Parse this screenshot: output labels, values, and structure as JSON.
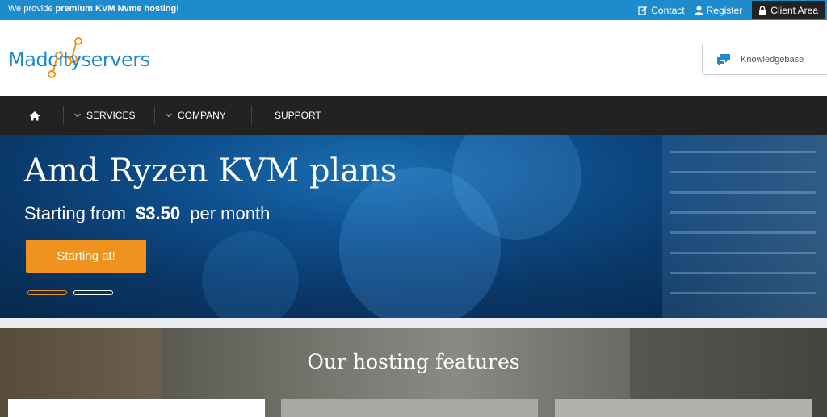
{
  "topbar": {
    "promo_prefix": "We provide ",
    "promo_bold": "premium KVM Nvme hosting!",
    "contact": "Contact",
    "register": "Register",
    "client_area": "Client Area"
  },
  "header": {
    "logo_text": "Madcityservers",
    "knowledgebase": "Knowledgebase"
  },
  "nav": {
    "home_icon": "home-icon",
    "services": "SERVICES",
    "company": "COMPANY",
    "support": "SUPPORT"
  },
  "hero": {
    "title": "Amd Ryzen KVM plans",
    "sub_prefix": "Starting from",
    "price": "$3.50",
    "sub_suffix": "per month",
    "button": "Starting at!",
    "slides_total": 2,
    "active_slide": 1
  },
  "features": {
    "title": "Our hosting features"
  },
  "colors": {
    "brand_blue": "#1e8ccc",
    "accent_orange": "#f0921e",
    "nav_dark": "#222222"
  }
}
